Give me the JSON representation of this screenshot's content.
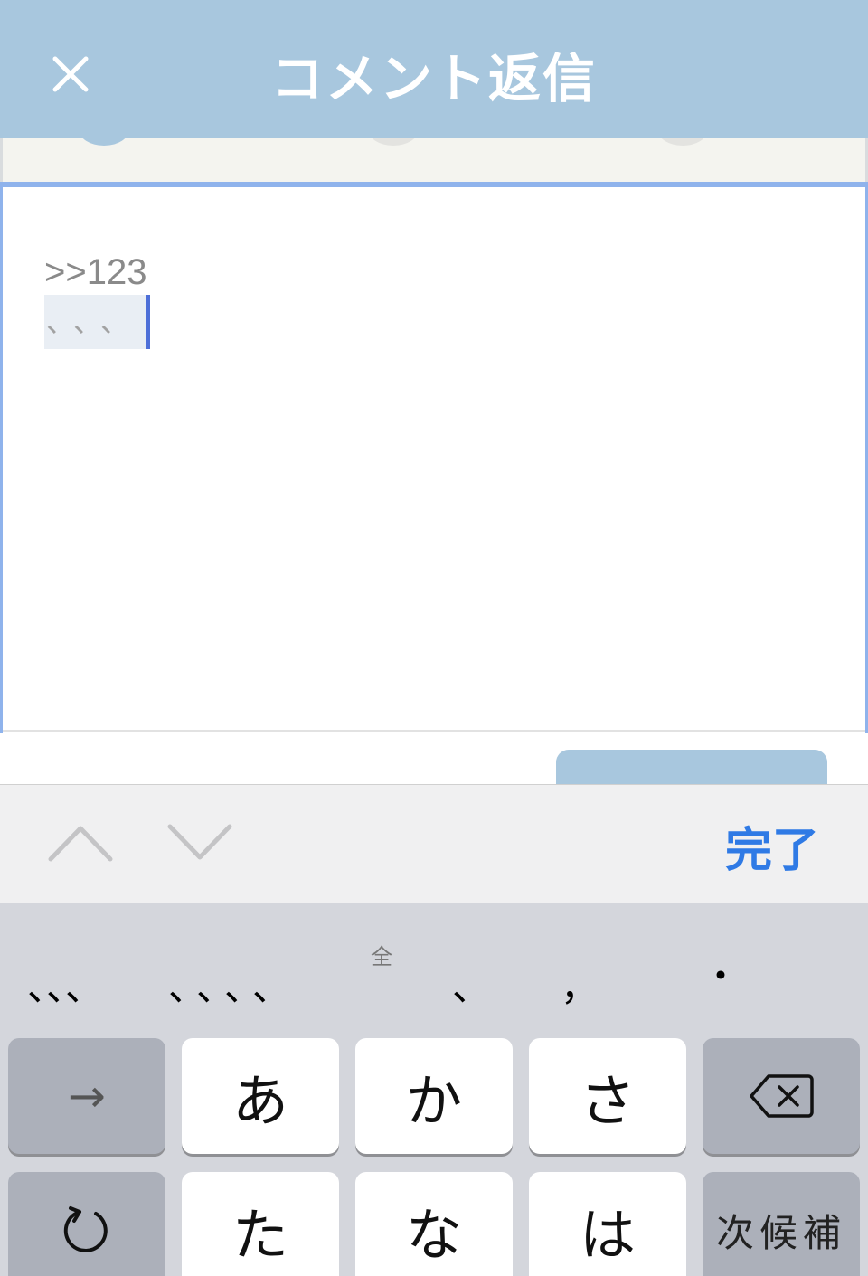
{
  "header": {
    "title": "コメント返信",
    "close_icon": "close-icon",
    "background": "#a8c7de"
  },
  "editor": {
    "reply_reference": ">>123",
    "marked_text": "、、、"
  },
  "toolbar": {
    "prev_icon": "chevron-up-icon",
    "next_icon": "chevron-down-icon",
    "done_label": "完了",
    "accent": "#2f7ae5"
  },
  "keyboard": {
    "candidates": [
      "、、、",
      "、、、、",
      "、",
      "，",
      "・"
    ],
    "candidate_note": "全",
    "keys": {
      "arrow": "→",
      "a": "あ",
      "ka": "か",
      "sa": "さ",
      "delete_icon": "delete-backward-icon",
      "undo_icon": "undo-icon",
      "ta": "た",
      "na": "な",
      "ha": "は",
      "next_candidate": "次候補"
    }
  }
}
